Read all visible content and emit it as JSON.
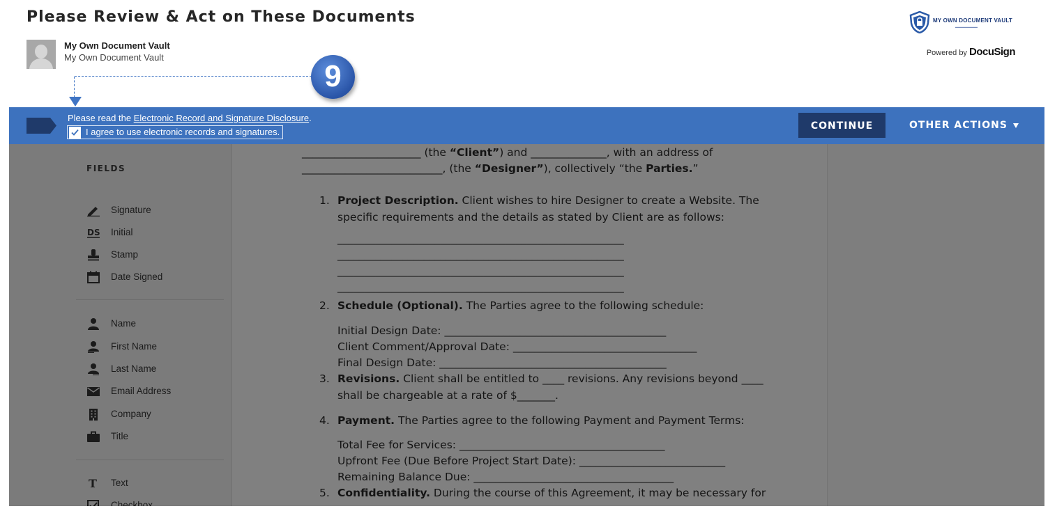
{
  "header": {
    "title": "Please Review & Act on These Documents",
    "sender_name": "My Own Document Vault",
    "sender_subtitle": "My Own Document Vault",
    "brand_logo_text": "MY OWN DOCUMENT VAULT",
    "powered_by_prefix": "Powered by",
    "powered_by_brand": "DocuSign"
  },
  "annotation": {
    "step_number": "9",
    "color": "#3f74c4"
  },
  "banner": {
    "line1_prefix": "Please read the ",
    "disclosure_link": "Electronic Record and Signature Disclosure",
    "line1_suffix": ".",
    "agree_label": "I agree to use electronic records and signatures.",
    "agree_checked": true,
    "continue_label": "CONTINUE",
    "other_actions_label": "OTHER ACTIONS",
    "background_color": "#3d72be",
    "continue_color": "#1f3a6a"
  },
  "sidebar": {
    "title": "FIELDS",
    "group1": [
      {
        "label": "Signature",
        "icon": "pen-icon"
      },
      {
        "label": "Initial",
        "icon": "ds-initial-icon"
      },
      {
        "label": "Stamp",
        "icon": "stamp-icon"
      },
      {
        "label": "Date Signed",
        "icon": "calendar-icon"
      }
    ],
    "group2": [
      {
        "label": "Name",
        "icon": "person-icon"
      },
      {
        "label": "First Name",
        "icon": "person-first-icon"
      },
      {
        "label": "Last Name",
        "icon": "person-last-icon"
      },
      {
        "label": "Email Address",
        "icon": "envelope-icon"
      },
      {
        "label": "Company",
        "icon": "building-icon"
      },
      {
        "label": "Title",
        "icon": "briefcase-icon"
      }
    ],
    "group3": [
      {
        "label": "Text",
        "icon": "text-icon"
      },
      {
        "label": "Checkbox",
        "icon": "checkbox-icon"
      }
    ]
  },
  "document": {
    "l1_blank_a": "______________________ ",
    "l1_client_open": "(the ",
    "l1_client": "“Client”",
    "l1_and": ") and ______________, with an address of",
    "l2_blank": "__________________________, (the ",
    "l2_designer": "“Designer”",
    "l2_mid": "), collectively “the ",
    "l2_parties": "Parties.",
    "l2_end": "”",
    "s1_num": "1.",
    "s1_title": "Project Description.",
    "s1_text": " Client wishes to hire Designer to create a Website. The",
    "s1_text2": "specific requirements and the details as stated by Client are as follows:",
    "blank_line": "_____________________________________________________",
    "s2_num": "2.",
    "s2_title": "Schedule (Optional).",
    "s2_text": " The Parties agree to the following schedule:",
    "s2_a": "Initial Design Date: _________________________________________",
    "s2_b": "Client Comment/Approval Date: __________________________________",
    "s2_c": "Final Design Date: __________________________________________",
    "s3_num": "3.",
    "s3_title": "Revisions.",
    "s3_text": " Client shall be entitled to ____ revisions. Any revisions beyond ____",
    "s3_text2": "shall be chargeable at a rate of $_______.",
    "s4_num": "4.",
    "s4_title": "Payment.",
    "s4_text": " The Parties agree to the following Payment and Payment Terms:",
    "s4_a": "Total Fee for Services: ______________________________________",
    "s4_b": "Upfront Fee (Due Before Project Start Date): ___________________________",
    "s4_c": "Remaining Balance Due: _____________________________________",
    "s5_num": "5.",
    "s5_title": "Confidentiality.",
    "s5_text": " During the course of this Agreement, it may be necessary for"
  }
}
